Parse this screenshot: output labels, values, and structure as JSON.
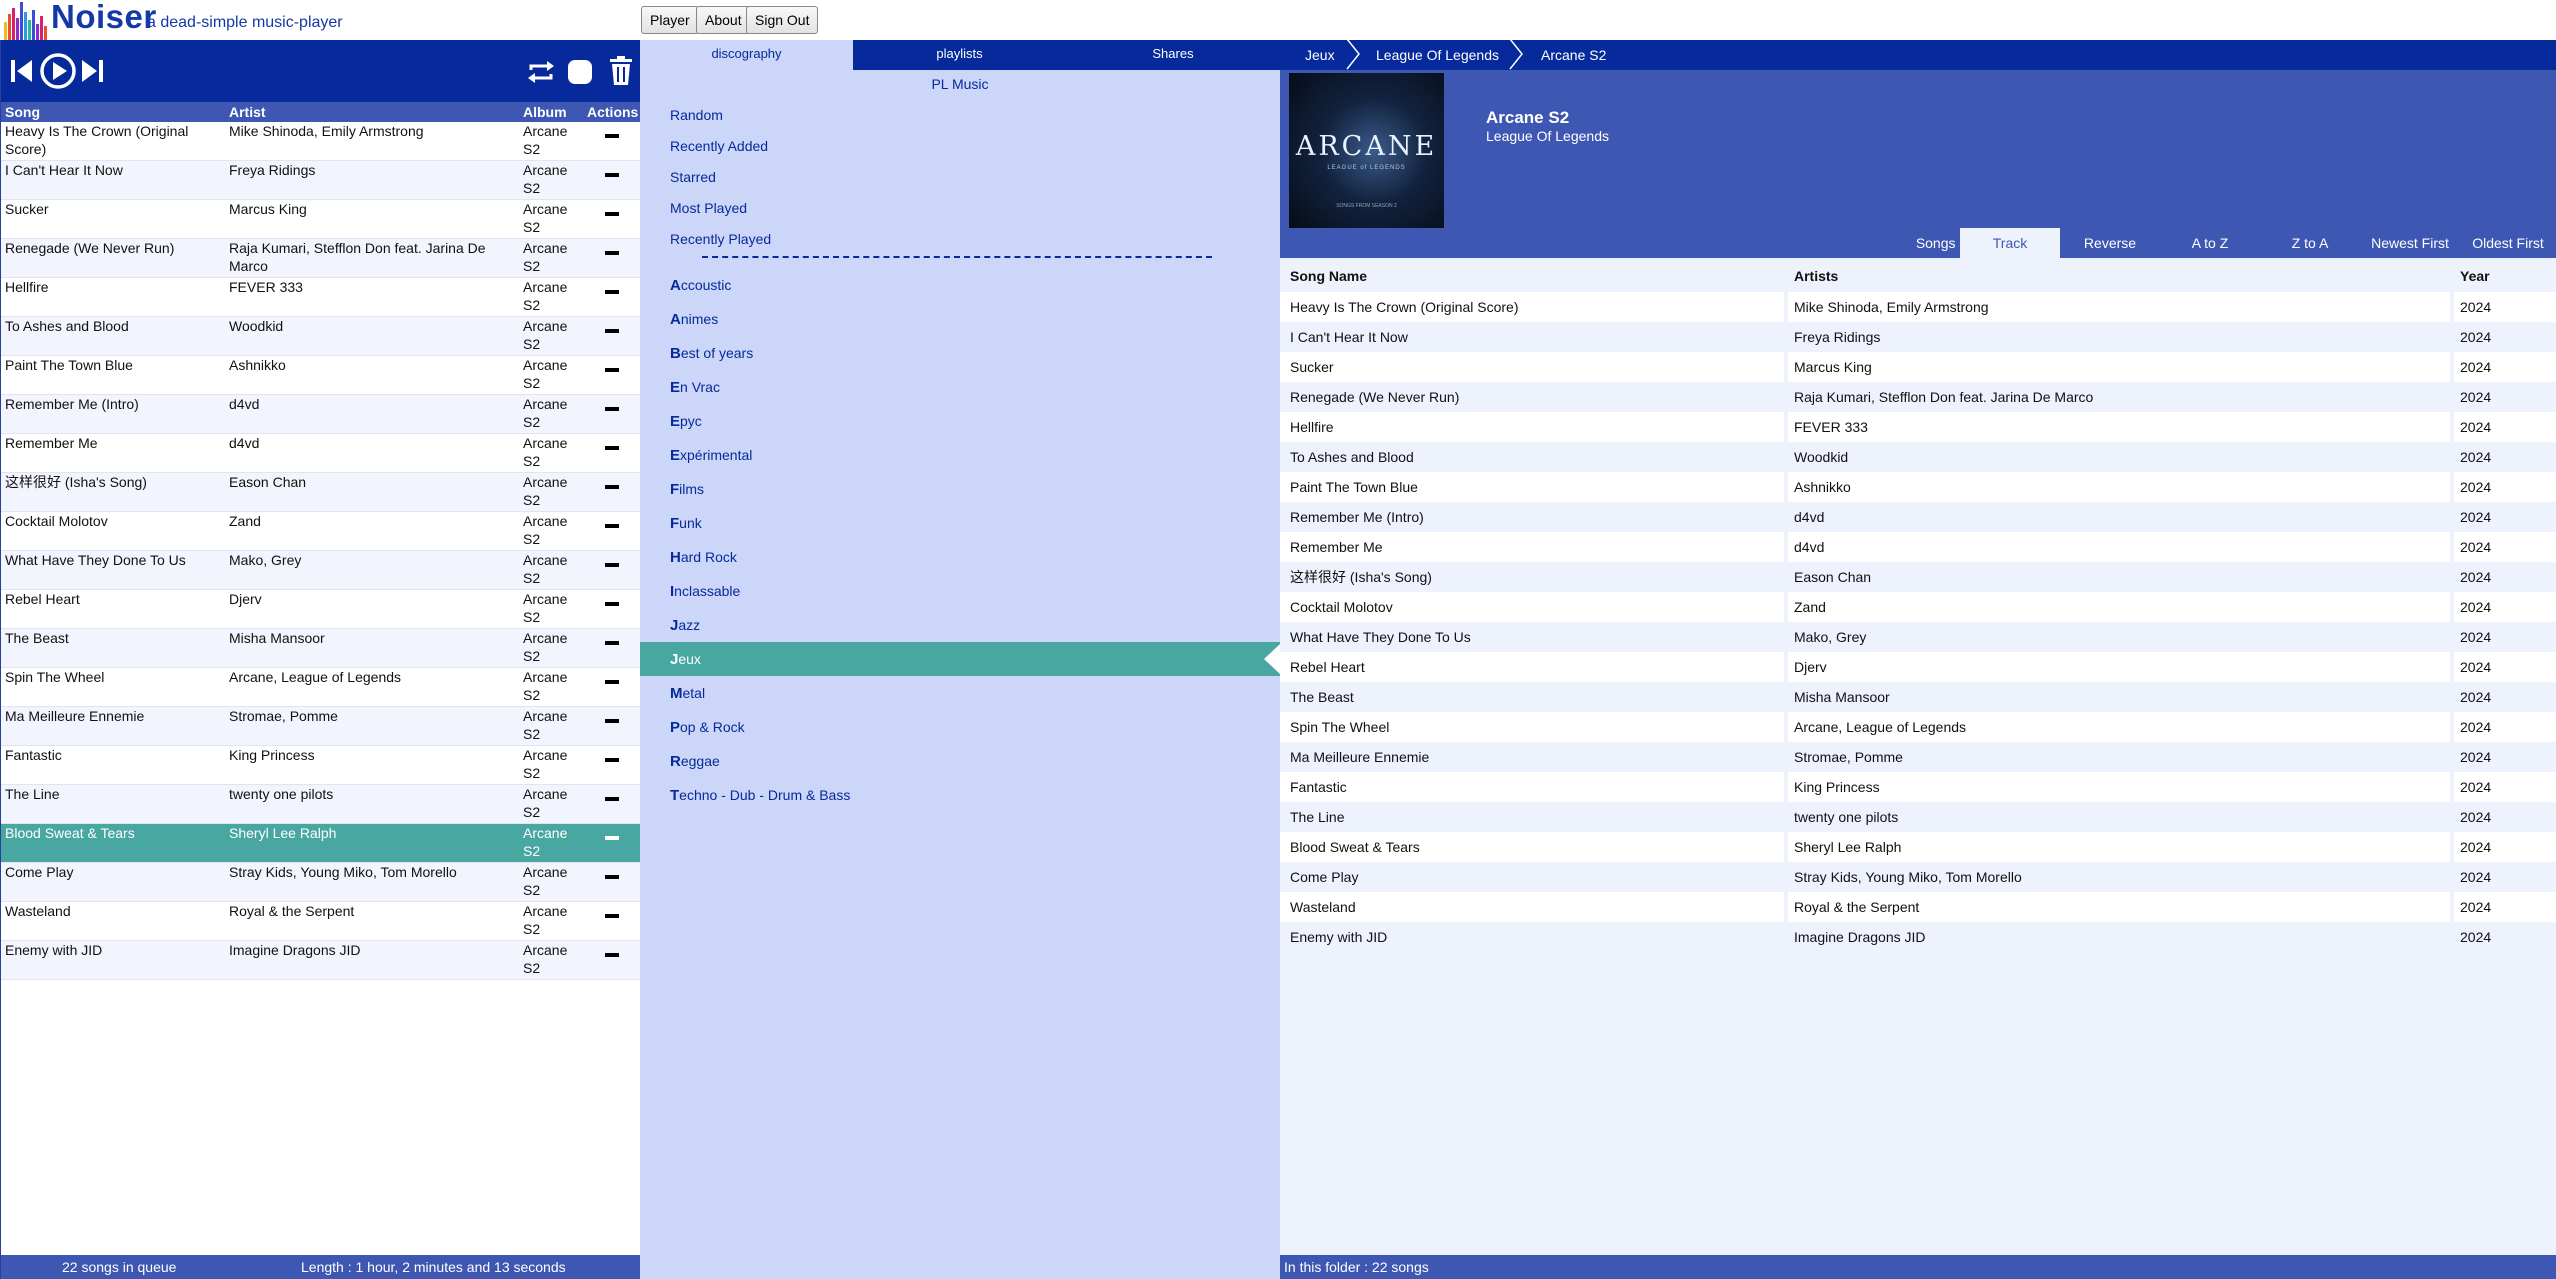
{
  "app": {
    "name": "Noiser",
    "tagline": "a dead-simple music-player",
    "nav": [
      "Player",
      "About",
      "Sign Out"
    ]
  },
  "queue": {
    "columns": [
      "Song",
      "Artist",
      "Album",
      "Actions"
    ],
    "active_index": 18,
    "rows": [
      {
        "song": "Heavy Is The Crown (Original Score)",
        "artist": "Mike Shinoda, Emily Armstrong",
        "album": "Arcane S2"
      },
      {
        "song": "I Can't Hear It Now",
        "artist": "Freya Ridings",
        "album": "Arcane S2"
      },
      {
        "song": "Sucker",
        "artist": "Marcus King",
        "album": "Arcane S2"
      },
      {
        "song": "Renegade (We Never Run)",
        "artist": "Raja Kumari, Stefflon Don feat. Jarina De Marco",
        "album": "Arcane S2"
      },
      {
        "song": "Hellfire",
        "artist": "FEVER 333",
        "album": "Arcane S2"
      },
      {
        "song": "To Ashes and Blood",
        "artist": "Woodkid",
        "album": "Arcane S2"
      },
      {
        "song": "Paint The Town Blue",
        "artist": "Ashnikko",
        "album": "Arcane S2"
      },
      {
        "song": "Remember Me (Intro)",
        "artist": "d4vd",
        "album": "Arcane S2"
      },
      {
        "song": "Remember Me",
        "artist": "d4vd",
        "album": "Arcane S2"
      },
      {
        "song": "这样很好 (Isha's Song)",
        "artist": "Eason Chan",
        "album": "Arcane S2"
      },
      {
        "song": "Cocktail Molotov",
        "artist": "Zand",
        "album": "Arcane S2"
      },
      {
        "song": "What Have They Done To Us",
        "artist": "Mako, Grey",
        "album": "Arcane S2"
      },
      {
        "song": "Rebel Heart",
        "artist": "Djerv",
        "album": "Arcane S2"
      },
      {
        "song": "The Beast",
        "artist": "Misha Mansoor",
        "album": "Arcane S2"
      },
      {
        "song": "Spin The Wheel",
        "artist": "Arcane, League of Legends",
        "album": "Arcane S2"
      },
      {
        "song": "Ma Meilleure Ennemie",
        "artist": "Stromae, Pomme",
        "album": "Arcane S2"
      },
      {
        "song": "Fantastic",
        "artist": "King Princess",
        "album": "Arcane S2"
      },
      {
        "song": "The Line",
        "artist": "twenty one pilots",
        "album": "Arcane S2"
      },
      {
        "song": "Blood Sweat & Tears",
        "artist": "Sheryl Lee Ralph",
        "album": "Arcane S2"
      },
      {
        "song": "Come Play",
        "artist": "Stray Kids, Young Miko, Tom Morello",
        "album": "Arcane S2"
      },
      {
        "song": "Wasteland",
        "artist": "Royal & the Serpent",
        "album": "Arcane S2"
      },
      {
        "song": "Enemy with JID",
        "artist": "Imagine Dragons JID",
        "album": "Arcane S2"
      }
    ],
    "footer": {
      "count": "22 songs in queue",
      "length": "Length :  1 hour, 2 minutes and  13 seconds"
    }
  },
  "middle": {
    "tabs": [
      "discography",
      "playlists",
      "Shares"
    ],
    "selected_tab": 0,
    "title": "PL Music",
    "specials": [
      "Random",
      "Recently Added",
      "Starred",
      "Most Played",
      "Recently Played"
    ],
    "folders": [
      {
        "first": "A",
        "rest": "ccoustic"
      },
      {
        "first": "A",
        "rest": "nimes"
      },
      {
        "first": "B",
        "rest": "est of years"
      },
      {
        "first": "E",
        "rest": "n Vrac"
      },
      {
        "first": "E",
        "rest": "pyc"
      },
      {
        "first": "E",
        "rest": "xpérimental"
      },
      {
        "first": "F",
        "rest": "ilms"
      },
      {
        "first": "F",
        "rest": "unk"
      },
      {
        "first": "H",
        "rest": "ard Rock"
      },
      {
        "first": "I",
        "rest": "nclassable"
      },
      {
        "first": "J",
        "rest": "azz"
      },
      {
        "first": "J",
        "rest": "eux"
      },
      {
        "first": "M",
        "rest": "etal"
      },
      {
        "first": "P",
        "rest": "op & Rock"
      },
      {
        "first": "R",
        "rest": "eggae"
      },
      {
        "first": "T",
        "rest": "echno - Dub - Drum & Bass"
      }
    ],
    "active_folder": 11
  },
  "right": {
    "breadcrumb": [
      "Jeux",
      "League Of Legends",
      "Arcane S2"
    ],
    "album": {
      "title": "Arcane S2",
      "artist": "League Of Legends",
      "cover_text": "ARCANE",
      "cover_subtext": "LEAGUE of LEGENDS",
      "cover_bottom": "SONGS FROM SEASON 2"
    },
    "sort": {
      "label": "Songs by",
      "options": [
        "Track",
        "Reverse",
        "A to Z",
        "Z to A",
        "Newest First",
        "Oldest First"
      ],
      "selected": 0
    },
    "columns": [
      "Song Name",
      "Artists",
      "Year"
    ],
    "tracks": [
      {
        "name": "Heavy Is The Crown (Original Score)",
        "artist": "Mike Shinoda, Emily Armstrong",
        "year": "2024"
      },
      {
        "name": "I Can't Hear It Now",
        "artist": "Freya Ridings",
        "year": "2024"
      },
      {
        "name": "Sucker",
        "artist": "Marcus King",
        "year": "2024"
      },
      {
        "name": "Renegade (We Never Run)",
        "artist": "Raja Kumari, Stefflon Don feat. Jarina De Marco",
        "year": "2024"
      },
      {
        "name": "Hellfire",
        "artist": "FEVER 333",
        "year": "2024"
      },
      {
        "name": "To Ashes and Blood",
        "artist": "Woodkid",
        "year": "2024"
      },
      {
        "name": "Paint The Town Blue",
        "artist": "Ashnikko",
        "year": "2024"
      },
      {
        "name": "Remember Me (Intro)",
        "artist": "d4vd",
        "year": "2024"
      },
      {
        "name": "Remember Me",
        "artist": "d4vd",
        "year": "2024"
      },
      {
        "name": "这样很好 (Isha's Song)",
        "artist": "Eason Chan",
        "year": "2024"
      },
      {
        "name": "Cocktail Molotov",
        "artist": "Zand",
        "year": "2024"
      },
      {
        "name": "What Have They Done To Us",
        "artist": "Mako, Grey",
        "year": "2024"
      },
      {
        "name": "Rebel Heart",
        "artist": "Djerv",
        "year": "2024"
      },
      {
        "name": "The Beast",
        "artist": "Misha Mansoor",
        "year": "2024"
      },
      {
        "name": "Spin The Wheel",
        "artist": "Arcane, League of Legends",
        "year": "2024"
      },
      {
        "name": "Ma Meilleure Ennemie",
        "artist": "Stromae, Pomme",
        "year": "2024"
      },
      {
        "name": "Fantastic",
        "artist": "King Princess",
        "year": "2024"
      },
      {
        "name": "The Line",
        "artist": "twenty one pilots",
        "year": "2024"
      },
      {
        "name": "Blood Sweat & Tears",
        "artist": "Sheryl Lee Ralph",
        "year": "2024"
      },
      {
        "name": "Come Play",
        "artist": "Stray Kids, Young Miko, Tom Morello",
        "year": "2024"
      },
      {
        "name": "Wasteland",
        "artist": "Royal & the Serpent",
        "year": "2024"
      },
      {
        "name": "Enemy with JID",
        "artist": "Imagine Dragons JID",
        "year": "2024"
      }
    ],
    "footer": "In this folder : 22 songs"
  },
  "icons": {
    "previous": "skip-previous-icon",
    "play": "play-icon",
    "next": "skip-next-icon",
    "repeat": "repeat-icon",
    "stop": "stop-icon",
    "clear": "trash-icon",
    "remove": "remove-icon"
  },
  "colors": {
    "brand_dark": "#062a9c",
    "brand_mid": "#3e57b3",
    "panel_light": "#cbd6f8",
    "active_teal": "#48a7a1"
  }
}
